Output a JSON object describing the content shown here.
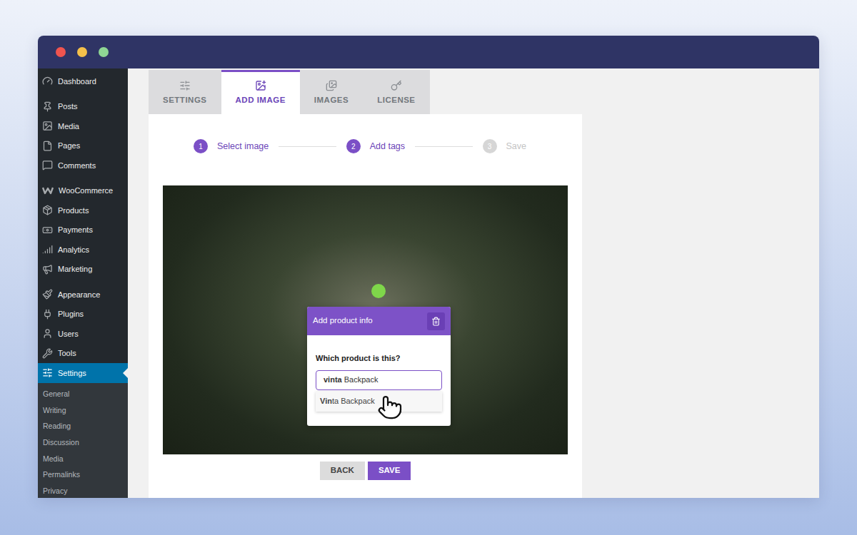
{
  "window_controls": [
    {
      "color": "#f0544f"
    },
    {
      "color": "#f5c04a"
    },
    {
      "color": "#8fd694"
    }
  ],
  "sidebar": {
    "groups": [
      [
        {
          "label": "Dashboard",
          "selected": false
        }
      ],
      [
        {
          "label": "Posts",
          "selected": false
        },
        {
          "label": "Media",
          "selected": false
        },
        {
          "label": "Pages",
          "selected": false
        },
        {
          "label": "Comments",
          "selected": false
        }
      ],
      [
        {
          "label": "WooCommerce",
          "selected": false
        },
        {
          "label": "Products",
          "selected": false
        },
        {
          "label": "Payments",
          "selected": false
        },
        {
          "label": "Analytics",
          "selected": false
        },
        {
          "label": "Marketing",
          "selected": false
        }
      ],
      [
        {
          "label": "Appearance",
          "selected": false
        },
        {
          "label": "Plugins",
          "selected": false
        },
        {
          "label": "Users",
          "selected": false
        },
        {
          "label": "Tools",
          "selected": false
        },
        {
          "label": "Settings",
          "selected": true
        }
      ]
    ],
    "submenu": [
      {
        "label": "General",
        "selected": false
      },
      {
        "label": "Writing",
        "selected": false
      },
      {
        "label": "Reading",
        "selected": false
      },
      {
        "label": "Discussion",
        "selected": false
      },
      {
        "label": "Media",
        "selected": false
      },
      {
        "label": "Permalinks",
        "selected": false
      },
      {
        "label": "Privacy",
        "selected": false
      }
    ]
  },
  "tabs": [
    {
      "label": "SETTINGS",
      "selected": false
    },
    {
      "label": "ADD IMAGE",
      "selected": true
    },
    {
      "label": "IMAGES",
      "selected": false
    },
    {
      "label": "LICENSE",
      "selected": false
    }
  ],
  "steps": [
    {
      "number": "1",
      "label": "Select image",
      "done": true
    },
    {
      "number": "2",
      "label": "Add tags",
      "done": true
    },
    {
      "number": "3",
      "label": "Save",
      "done": false
    }
  ],
  "tag_popup": {
    "title": "Add product info",
    "question": "Which product is this?",
    "input": [
      {
        "text": "vinta",
        "bold": true
      },
      {
        "text": " Backpack",
        "bold": false
      }
    ],
    "suggestions": [
      {
        "parts": [
          {
            "text": "Vin",
            "bold": true
          },
          {
            "text": "ta Backpack",
            "bold": false
          }
        ],
        "hovered": true
      }
    ]
  },
  "buttons": [
    {
      "label": "BACK",
      "kind": "secondary"
    },
    {
      "label": "SAVE",
      "kind": "primary"
    }
  ]
}
